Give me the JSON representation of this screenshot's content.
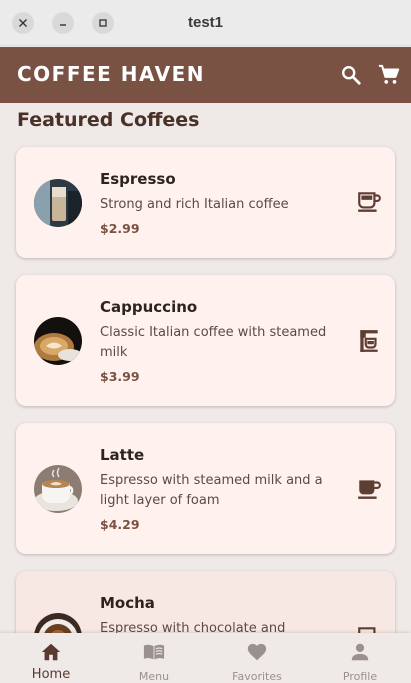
{
  "window": {
    "title": "test1"
  },
  "appbar": {
    "title": "COFFEE HAVEN",
    "icons": [
      "search-icon",
      "cart-icon"
    ],
    "color": "#7a5243"
  },
  "section": {
    "title": "Featured Coffees"
  },
  "products": [
    {
      "name": "Espresso",
      "description": "Strong and rich Italian coffee",
      "price": "$2.99",
      "icon": "coffee-cup-icon"
    },
    {
      "name": "Cappuccino",
      "description": "Classic Italian coffee with steamed milk",
      "price": "$3.99",
      "icon": "coffee-maker-icon"
    },
    {
      "name": "Latte",
      "description": "Espresso with steamed milk and a light layer of foam",
      "price": "$4.29",
      "icon": "coffee-cup-icon"
    },
    {
      "name": "Mocha",
      "description": "Espresso with chocolate and",
      "icon": "coffee-cup-icon"
    }
  ],
  "nav": {
    "items": [
      {
        "label": "Home",
        "icon": "home-icon",
        "active": true
      },
      {
        "label": "Menu",
        "icon": "menu-book-icon"
      },
      {
        "label": "Favorites",
        "icon": "heart-icon"
      },
      {
        "label": "Profile",
        "icon": "person-icon"
      }
    ]
  }
}
